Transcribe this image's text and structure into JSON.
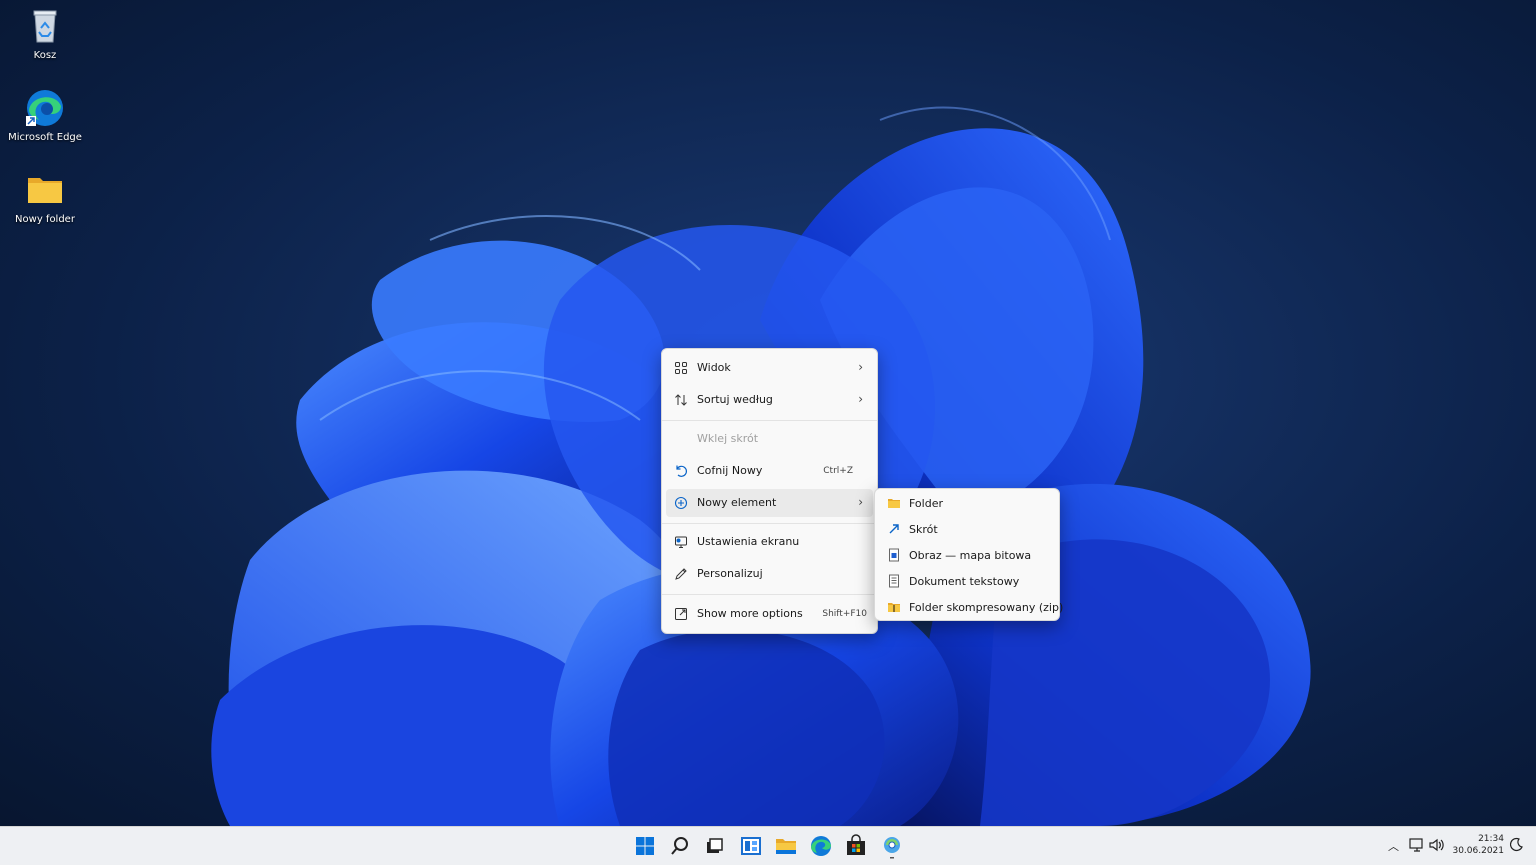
{
  "desktop": {
    "icons": [
      {
        "label": "Kosz",
        "icon": "recycle-bin-icon"
      },
      {
        "label": "Microsoft Edge",
        "icon": "edge-icon"
      },
      {
        "label": "Nowy folder",
        "icon": "folder-icon"
      }
    ]
  },
  "context_menu": {
    "items": [
      {
        "label": "Widok",
        "icon": "grid-icon",
        "submenu": true
      },
      {
        "label": "Sortuj według",
        "icon": "sort-icon",
        "submenu": true
      },
      {
        "label": "Wklej skrót",
        "disabled": true
      },
      {
        "label": "Cofnij Nowy",
        "icon": "undo-icon",
        "shortcut": "Ctrl+Z"
      },
      {
        "label": "Nowy element",
        "icon": "add-circle-icon",
        "submenu": true,
        "highlighted": true
      },
      {
        "label": "Ustawienia ekranu",
        "icon": "display-settings-icon"
      },
      {
        "label": "Personalizuj",
        "icon": "pen-icon"
      },
      {
        "label": "Show more options",
        "icon": "share-icon",
        "shortcut": "Shift+F10"
      }
    ]
  },
  "submenu": {
    "items": [
      {
        "label": "Folder",
        "icon": "folder-icon"
      },
      {
        "label": "Skrót",
        "icon": "shortcut-arrow-icon"
      },
      {
        "label": "Obraz — mapa bitowa",
        "icon": "bitmap-icon"
      },
      {
        "label": "Dokument tekstowy",
        "icon": "text-document-icon"
      },
      {
        "label": "Folder skompresowany (zip)",
        "icon": "zip-folder-icon"
      }
    ]
  },
  "taskbar": {
    "apps": [
      "start-icon",
      "search-icon",
      "task-view-icon",
      "widgets-icon",
      "file-explorer-icon",
      "edge-icon",
      "store-icon",
      "control-panel-icon"
    ],
    "clock": {
      "time": "21:34",
      "date": "30.06.2021"
    }
  },
  "colors": {
    "accent": "#0078d4",
    "folder": "#f7c843",
    "taskbar": "#eef0f3"
  }
}
